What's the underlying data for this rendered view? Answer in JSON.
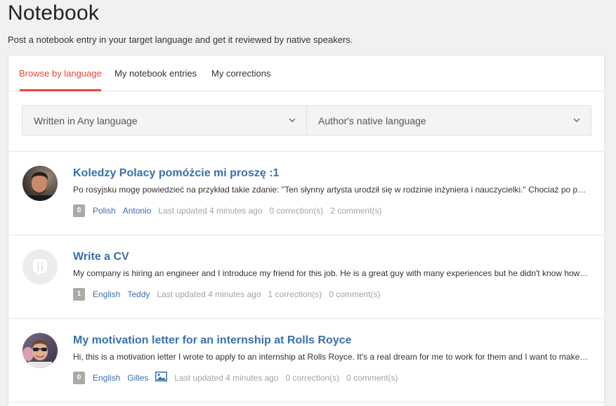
{
  "header": {
    "title": "Notebook",
    "subtitle": "Post a notebook entry in your target language and get it reviewed by native speakers."
  },
  "tabs": [
    {
      "label": "Browse by language",
      "active": true
    },
    {
      "label": "My notebook entries",
      "active": false
    },
    {
      "label": "My corrections",
      "active": false
    }
  ],
  "filters": {
    "written_in": "Written in Any language",
    "native_language": "Author's native language"
  },
  "colors": {
    "accent": "#e4463c",
    "link": "#3a6fb0",
    "muted": "#a3a3a3",
    "badge": "#aaaaaa"
  },
  "entries": [
    {
      "title": "Koledzy Polacy pomóżcie mi proszę :1",
      "excerpt": "Po rosyjsku mogę powiedzieć na przykład takie zdanie: \"Ten słynny artysta urodził się w rodzinie inżyniera i nauczycielki.\" Chociaż po polsku to zdanie brzmi dziwnie",
      "badge": "0",
      "language": "Polish",
      "author": "Antonio",
      "updated": "Last updated 4 minutes ago",
      "corrections": "0 correction(s)",
      "comments": "2 comment(s)",
      "avatar": "photo-man-icon"
    },
    {
      "title": "Write a CV",
      "excerpt": "My company is hiring an engineer and I introduce my friend for this job. He is a great guy with many experiences but he didn't know how to write a CV",
      "badge": "1",
      "language": "English",
      "author": "Teddy",
      "updated": "Last updated 4 minutes ago",
      "corrections": "1 correction(s)",
      "comments": "0 comment(s)",
      "avatar": "default-avatar-icon"
    },
    {
      "title": "My motivation letter for an internship at Rolls Royce",
      "excerpt": "Hi, this is a motivation letter I wrote to apply to an internship at Rolls Royce. It's a real dream for me to work for them and I want to make a good impression",
      "badge": "0",
      "language": "English",
      "author": "Gilles",
      "updated": "Last updated 4 minutes ago",
      "corrections": "0 correction(s)",
      "comments": "0 comment(s)",
      "avatar": "photo-man-sunglasses-icon",
      "has_image": true
    }
  ]
}
